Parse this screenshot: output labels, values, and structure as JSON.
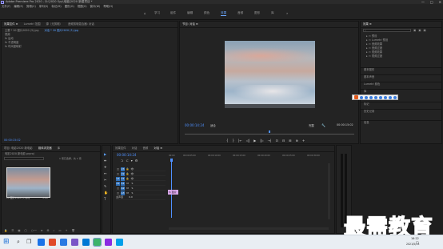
{
  "titlebar": {
    "title": "Adobe Premiere Pro 2020 - D:\\2020 Syy\\电脑\\2020 新建项目 *",
    "controls": [
      "—",
      "□",
      "✕"
    ]
  },
  "menubar": [
    "文件(F)",
    "编辑(E)",
    "剪辑(C)",
    "序列(S)",
    "标记(M)",
    "图形(G)",
    "视图(V)",
    "窗口(W)",
    "帮助(H)"
  ],
  "workspaces": [
    "学习",
    "组件",
    "编辑",
    "颜色",
    "效果",
    "音频",
    "图形",
    "库"
  ],
  "workspace_active": "效果",
  "effect_controls": {
    "tabs": [
      "效果控件 ≡",
      "Lumetri 范围",
      "源（无剪辑）",
      "音频剪辑混合器: 对话"
    ],
    "source_label": "主要 * 20 图片2020 (3).jpg",
    "sequence_label": "对话 * 20 图片2020 (3).jpg",
    "header": "视频",
    "rows": [
      "fx 运动",
      "fx 不透明度",
      "fx 时间重映射"
    ],
    "timecode": "00:00:15:02"
  },
  "program": {
    "tab": "节目: 对话 ≡",
    "timecode": "00:00:14:24",
    "zoom": "适合",
    "quality": "完整",
    "duration": "00:00:15:02",
    "controls": [
      "{",
      "}",
      "|←",
      "◁|",
      "▶",
      "|▷",
      "→|",
      "⊡",
      "⊟",
      "⊞",
      "⊕",
      "+"
    ]
  },
  "project": {
    "tabs": [
      "项目: 电影2020 新电影",
      "媒体浏览器",
      "库",
      "信息",
      "效果",
      "标记",
      "历史记录"
    ],
    "path": "电影2020 新电影.prproj",
    "item_count": "1 项已选择，共 1 项",
    "thumb_label": "20 图片2020 (3).jpg",
    "thumb_duration": "5:00"
  },
  "tools": [
    "▶",
    "⇹",
    "✛",
    "↔",
    "✂",
    "✎",
    "✋",
    "T"
  ],
  "timeline": {
    "tabs": [
      "效果控件",
      "对话",
      "音频",
      "对话 ≡"
    ],
    "timecode": "00:00:14:24",
    "ruler": [
      "00:00",
      "00:00:05:00",
      "00:00:10:00",
      "00:00:15:00",
      "00:00:20:00",
      "00:00:25:00",
      "00:00:30:00"
    ],
    "video_tracks": [
      "V3",
      "V2",
      "V1"
    ],
    "audio_tracks": [
      "A1",
      "A2",
      "A3"
    ],
    "master": "主声道",
    "master_value": "0.0",
    "clip_label": "fx 图片"
  },
  "effects": {
    "title": "效果 ≡",
    "search_placeholder": "",
    "folders": [
      "预设",
      "Lumetri 预设",
      "音频效果",
      "音频过渡",
      "视频效果",
      "视频过渡"
    ],
    "sections": [
      "基本图形",
      "基本声音",
      "Lumetri 颜色",
      "库",
      "标记",
      "历史记录",
      "信息"
    ]
  },
  "watermark": "最需教育",
  "taskbar": {
    "time": "16:22",
    "date": "2021/5/13",
    "colors": [
      "#1a73e8",
      "#e04b2a",
      "#2a7ae2",
      "#7a56c7",
      "#0078d4",
      "#3db36a",
      "#8a2be2",
      "#00a0e9"
    ]
  }
}
